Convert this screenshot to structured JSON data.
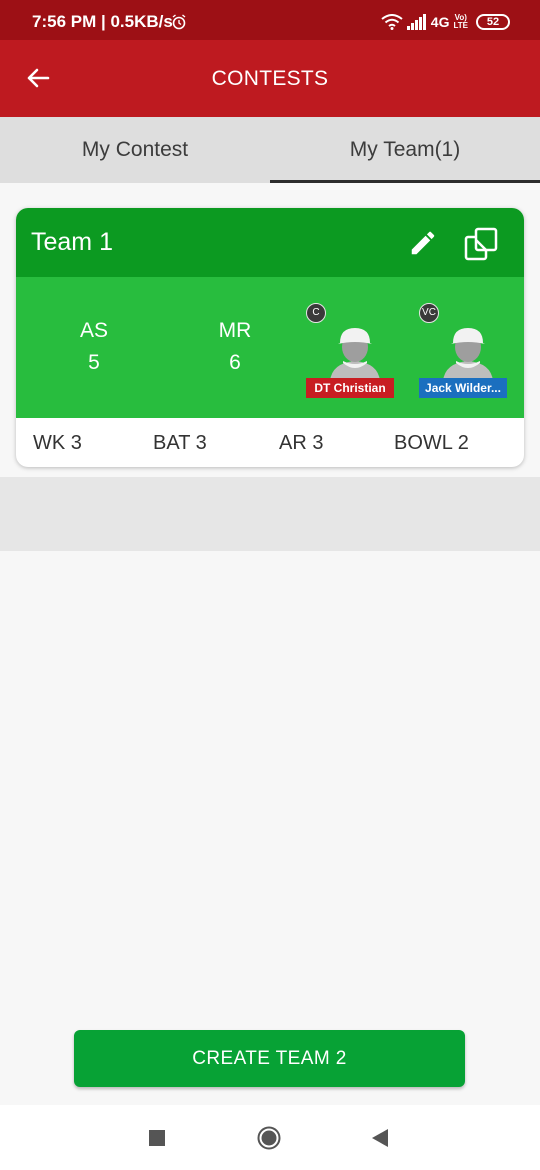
{
  "status_bar": {
    "time": "7:56 PM | 0.5KB/s",
    "network": "4G",
    "volte_line1": "Vo)",
    "volte_line2": "LTE",
    "battery": "52"
  },
  "app_bar": {
    "title": "CONTESTS"
  },
  "tabs": [
    {
      "label": "My Contest",
      "active": false
    },
    {
      "label": "My Team(1)",
      "active": true
    }
  ],
  "team_card": {
    "name": "Team 1",
    "teams": [
      {
        "abbr": "AS",
        "count": "5"
      },
      {
        "abbr": "MR",
        "count": "6"
      }
    ],
    "captain": {
      "badge": "C",
      "name": "DT Christian",
      "tag_color": "#c81d22"
    },
    "vice_captain": {
      "badge": "VC",
      "name": "Jack Wilder...",
      "tag_color": "#1b6fbf"
    },
    "roles": [
      {
        "label": "WK 3"
      },
      {
        "label": "BAT 3"
      },
      {
        "label": "AR 3"
      },
      {
        "label": "BOWL 2"
      }
    ]
  },
  "create_button": {
    "label": "CREATE TEAM 2"
  },
  "colors": {
    "status_bar": "#9d1015",
    "app_bar": "#be1a20",
    "card_header": "#0c9a21",
    "card_body": "#28bd3e",
    "create_button": "#07a235"
  },
  "icons": {
    "back": "arrow-left-icon",
    "edit": "pencil-icon",
    "clone": "copy-icon",
    "avatar": "player-avatar-icon",
    "alarm": "alarm-clock-icon",
    "wifi": "wifi-icon",
    "signal": "signal-bars-icon"
  }
}
